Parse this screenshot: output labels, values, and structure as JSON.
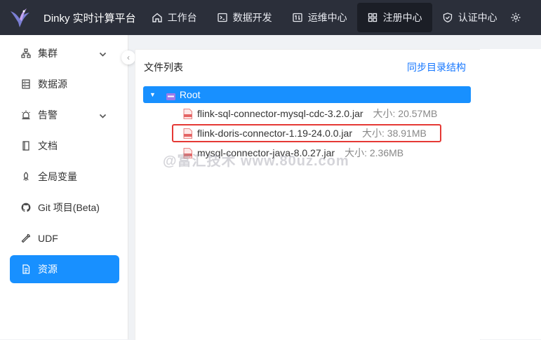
{
  "header": {
    "brand": "Dinky 实时计算平台",
    "nav": [
      {
        "label": "工作台",
        "icon": "home-icon"
      },
      {
        "label": "数据开发",
        "icon": "terminal-icon"
      },
      {
        "label": "运维中心",
        "icon": "ops-icon"
      },
      {
        "label": "注册中心",
        "icon": "grid-icon",
        "active": true
      },
      {
        "label": "认证中心",
        "icon": "shield-icon"
      }
    ]
  },
  "sidebar": {
    "items": [
      {
        "label": "集群",
        "icon": "cluster-icon",
        "expandable": true
      },
      {
        "label": "数据源",
        "icon": "database-icon"
      },
      {
        "label": "告警",
        "icon": "alarm-icon",
        "expandable": true
      },
      {
        "label": "文档",
        "icon": "document-icon"
      },
      {
        "label": "全局变量",
        "icon": "variable-icon"
      },
      {
        "label": "Git 项目(Beta)",
        "icon": "github-icon"
      },
      {
        "label": "UDF",
        "icon": "tool-icon"
      },
      {
        "label": "资源",
        "icon": "resource-icon",
        "active": true
      }
    ]
  },
  "panel": {
    "title": "文件列表",
    "sync_label": "同步目录结构",
    "root_label": "Root",
    "files": [
      {
        "name": "flink-sql-connector-mysql-cdc-3.2.0.jar",
        "size": "大小: 20.57MB"
      },
      {
        "name": "flink-doris-connector-1.19-24.0.0.jar",
        "size": "大小: 38.91MB",
        "highlighted": true
      },
      {
        "name": "mysql-connector-java-8.0.27.jar",
        "size": "大小: 2.36MB"
      }
    ]
  },
  "watermark": "@富汇技术 www.80uz.com",
  "colors": {
    "primary": "#1890ff",
    "topbar": "#2b2f3a",
    "highlight_border": "#e53935"
  }
}
